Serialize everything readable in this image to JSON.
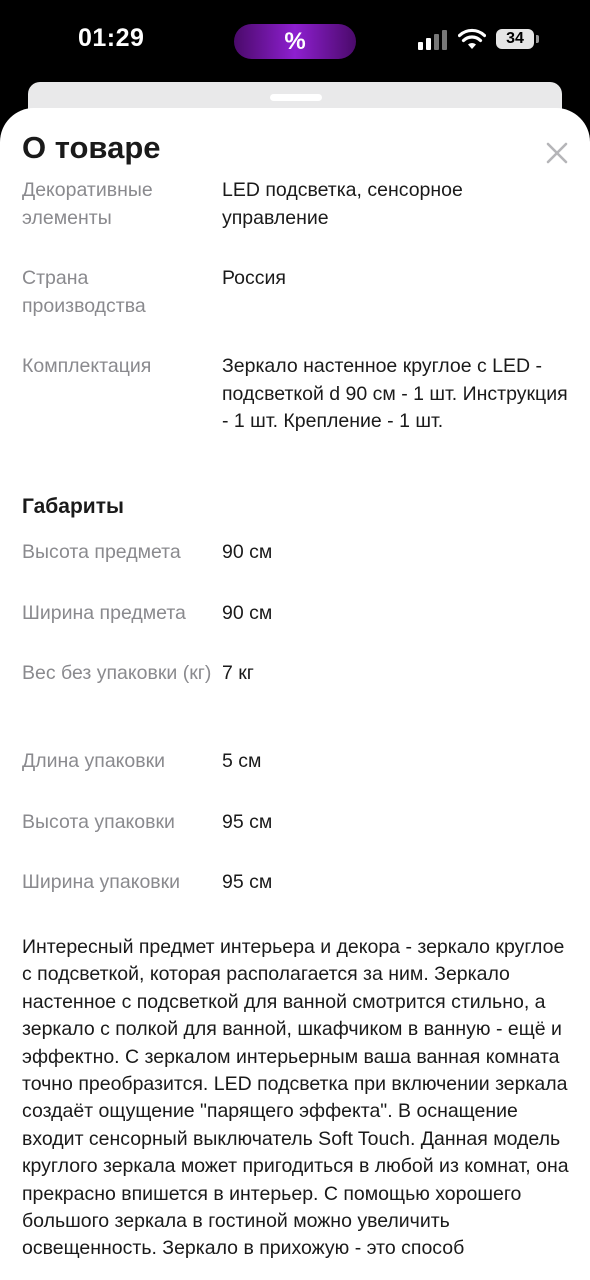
{
  "status_bar": {
    "time": "01:29",
    "island_glyph": "%",
    "battery": "34",
    "icons": [
      "cellular-signal-icon",
      "wifi-icon",
      "battery-icon"
    ],
    "island_color": "#8e1fd0"
  },
  "sheet": {
    "title": "О товаре",
    "close_icon": "close-icon"
  },
  "details": [
    {
      "label": "Декоративные элементы",
      "value": "LED подсветка, сенсорное управление"
    },
    {
      "label": "Страна производства",
      "value": "Россия"
    },
    {
      "label": "Комплектация",
      "value": "Зеркало настенное круглое с LED - подсветкой d 90 см - 1 шт. Инструкция - 1 шт. Крепление - 1 шт."
    }
  ],
  "dimensions": {
    "title": "Габариты",
    "rows": [
      {
        "label": "Высота предмета",
        "value": "90 см"
      },
      {
        "label": "Ширина предмета",
        "value": "90 см"
      },
      {
        "label": "Вес без упаковки (кг)",
        "value": "7 кг"
      },
      {
        "label": "Длина упаковки",
        "value": "5 см"
      },
      {
        "label": "Высота упаковки",
        "value": "95 см"
      },
      {
        "label": "Ширина упаковки",
        "value": "95 см"
      }
    ]
  },
  "description": "Интересный предмет интерьера и декора - зеркало круглое с подсветкой, которая располагается за ним. Зеркало настенное с подсветкой для ванной смотрится стильно, а зеркало с полкой для ванной, шкафчиком в ванную - ещё и эффектно. С зеркалом интерьерным ваша ванная комната точно преобразится. LED подсветка при включении зеркала создаёт ощущение \"парящего эффекта\". В оснащение входит сенсорный выключатель Soft Touch. Данная модель круглого зеркала может пригодиться в любой из комнат, она прекрасно впишется в интерьер. С помощью хорошего большого зеркала в гостиной можно увеличить освещенность. Зеркало в прихожую - это способ"
}
